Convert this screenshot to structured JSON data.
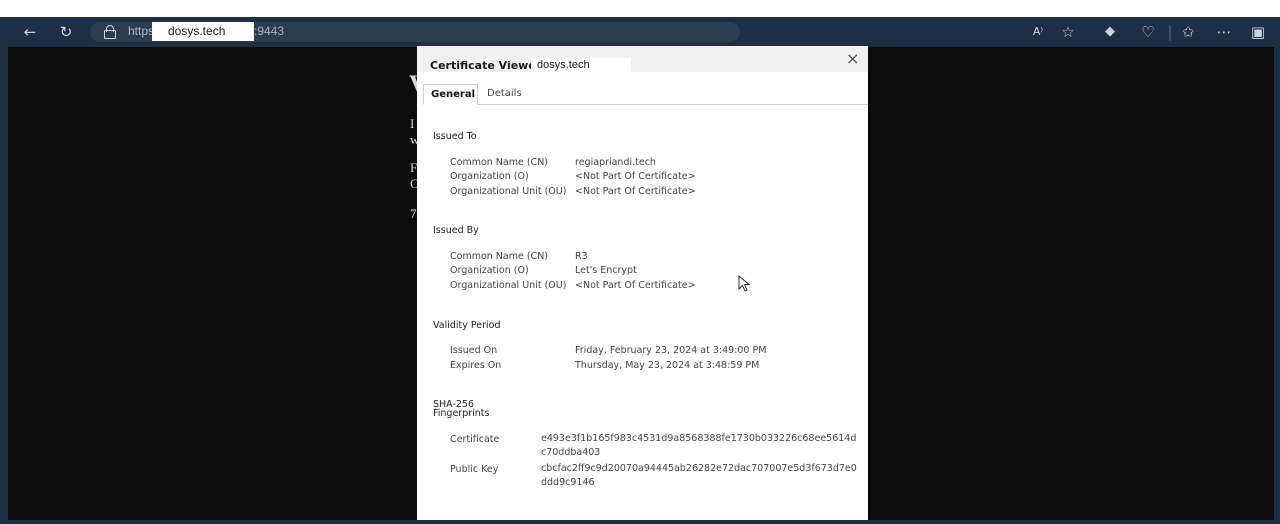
{
  "browser": {
    "url_scheme": "https://",
    "url_host": "dosys.tech",
    "url_port": ":9443",
    "icons": [
      "back-arrow-icon",
      "refresh-icon",
      "lock-icon",
      "read-aloud-icon",
      "favorite-star-icon",
      "extension-icon",
      "browser-essentials-icon",
      "favorites-icon",
      "more-icon",
      "sidebar-icon"
    ]
  },
  "dialog": {
    "title": "Certificate Viewer:",
    "host": "dosys.tech",
    "close_glyph": "×",
    "tabs": [
      {
        "label": "General"
      },
      {
        "label": "Details"
      }
    ],
    "issued_to": {
      "heading": "Issued To",
      "rows": [
        {
          "label": "Common Name (CN)",
          "value": "regiapriandi.tech"
        },
        {
          "label": "Organization (O)",
          "value": "<Not Part Of Certificate>"
        },
        {
          "label": "Organizational Unit (OU)",
          "value": "<Not Part Of Certificate>"
        }
      ]
    },
    "issued_by": {
      "heading": "Issued By",
      "rows": [
        {
          "label": "Common Name (CN)",
          "value": "R3"
        },
        {
          "label": "Organization (O)",
          "value": "Let's Encrypt"
        },
        {
          "label": "Organizational Unit (OU)",
          "value": "<Not Part Of Certificate>"
        }
      ]
    },
    "validity": {
      "heading": "Validity Period",
      "rows": [
        {
          "label": "Issued On",
          "value": "Friday, February 23, 2024 at 3:49:00 PM"
        },
        {
          "label": "Expires On",
          "value": "Thursday, May 23, 2024 at 3:48:59 PM"
        }
      ]
    },
    "fingerprints": {
      "heading_line1": "SHA-256",
      "heading_line2": "Fingerprints",
      "rows": [
        {
          "label": "Certificate",
          "value": "e493e3f1b165f983c4531d9a8568388fe1730b033226c68ee5614dc70ddba403"
        },
        {
          "label": "Public Key",
          "value": "cbcfac2ff9c9d20070a94445ab26282e72dac707007e5d3f673d7e0ddd9c9146"
        }
      ]
    }
  },
  "background_page": {
    "letters": [
      "V",
      "I",
      "w",
      "F",
      "C",
      "7"
    ]
  }
}
